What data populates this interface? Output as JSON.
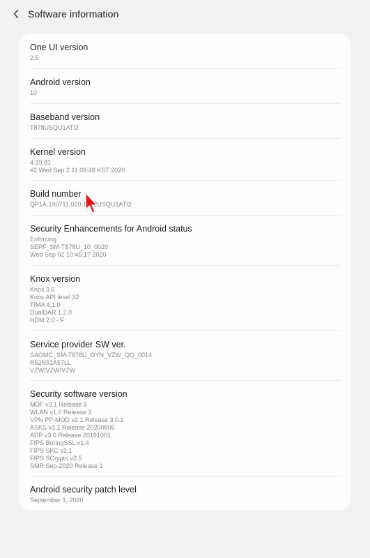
{
  "header": {
    "title": "Software information",
    "back_icon": "chevron-left-icon"
  },
  "items": [
    {
      "title": "One UI version",
      "values": [
        "2.5"
      ]
    },
    {
      "title": "Android version",
      "values": [
        "10"
      ]
    },
    {
      "title": "Baseband version",
      "values": [
        "T878USQU1ATI2"
      ]
    },
    {
      "title": "Kernel version",
      "values": [
        "4.19.81",
        "#2 Wed Sep 2 11:09:48 KST 2020"
      ]
    },
    {
      "title": "Build number",
      "values": [
        "QP1A.190711.020.T878USQU1ATI2"
      ]
    },
    {
      "title": "Security Enhancements for Android status",
      "values": [
        "Enforcing",
        "SEPF_SM-T878U_10_0020",
        "Wed Sep 02 10:45:17 2020"
      ]
    },
    {
      "title": "Knox version",
      "values": [
        "Knox 3.6",
        "Knox API level 32",
        "TIMA 4.1.0",
        "DualDAR 1.2.0",
        "HDM 2.0 - F"
      ]
    },
    {
      "title": "Service provider SW ver.",
      "values": [
        "SAOMC_SM-T878U_OYN_VZW_QQ_0014",
        "R52N91A57LL",
        "VZW/VZW/VZW"
      ]
    },
    {
      "title": "Security software version",
      "values": [
        "MDF v3.1 Release 5",
        "WLAN v1.0 Release 2",
        "VPN PP-MOD v2.1 Release 3.0.1",
        "ASKS v3.1 Release 20200806",
        "ADP v3.0 Release 20191001",
        "FIPS BoringSSL v1.4",
        "FIPS SKC v2.1",
        "FIPS SCrypto v2.5",
        "SMR Sep-2020 Release 1"
      ]
    },
    {
      "title": "Android security patch level",
      "values": [
        "September 1, 2020"
      ]
    }
  ],
  "colors": {
    "background": "#f2f2f2",
    "card": "#fcfcfc",
    "title_text": "#1f1f1f",
    "value_text": "#8a8a8a",
    "cursor": "#e8191b"
  }
}
